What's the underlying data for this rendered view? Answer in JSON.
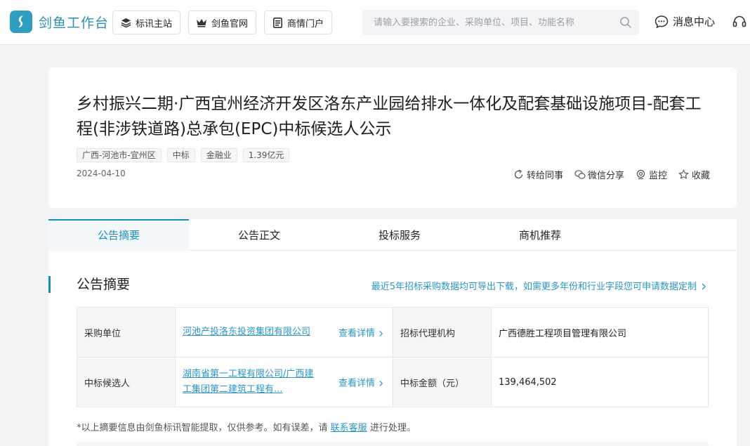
{
  "brand": {
    "name": "剑鱼工作台"
  },
  "nav": [
    {
      "label": "标讯主站",
      "icon": "layers-icon"
    },
    {
      "label": "剑鱼官网",
      "icon": "crown-icon"
    },
    {
      "label": "商情门户",
      "icon": "document-icon"
    }
  ],
  "search": {
    "placeholder": "请输入要搜索的企业、采购单位、项目、功能名称",
    "value": ""
  },
  "header_right": {
    "messages": "消息中心"
  },
  "notice": {
    "title": "乡村振兴二期·广西宜州经济开发区洛东产业园给排水一体化及配套基础设施项目-配套工程(非涉铁道路)总承包(EPC)中标候选人公示",
    "tags": [
      "广西-河池市-宜州区",
      "中标",
      "金融业",
      "1.39亿元"
    ],
    "date": "2024-04-10",
    "actions": [
      {
        "label": "转给同事",
        "icon": "share-forward-icon"
      },
      {
        "label": "微信分享",
        "icon": "wechat-icon"
      },
      {
        "label": "监控",
        "icon": "monitor-camera-icon"
      },
      {
        "label": "收藏",
        "icon": "star-icon"
      }
    ]
  },
  "tabs": [
    {
      "label": "公告摘要",
      "active": true
    },
    {
      "label": "公告正文",
      "active": false
    },
    {
      "label": "投标服务",
      "active": false
    },
    {
      "label": "商机推荐",
      "active": false
    }
  ],
  "summary": {
    "title": "公告摘要",
    "export_link": "最近5年招标采购数据均可导出下载，如需更多年份和行业字段您可申请数据定制",
    "rows": [
      {
        "label1": "采购单位",
        "value1": "河池产投洛东投资集团有限公司",
        "detail": "查看详情",
        "label2": "招标代理机构",
        "value2": "广西德胜工程项目管理有限公司"
      },
      {
        "label1": "中标候选人",
        "value1": "湖南省第一工程有限公司/广西建工集团第二建筑工程有...",
        "detail": "查看详情",
        "label2": "中标金额（元）",
        "value2": "139,464,502"
      }
    ],
    "note_prefix": "*以上摘要信息由剑鱼标讯智能提取，仅供参考。如有误差，请",
    "note_link": "联系客服",
    "note_suffix": "进行处理。"
  },
  "colors": {
    "accent": "#1e8cb8",
    "link": "#2a95c4",
    "logo": "#2f9fbf"
  }
}
